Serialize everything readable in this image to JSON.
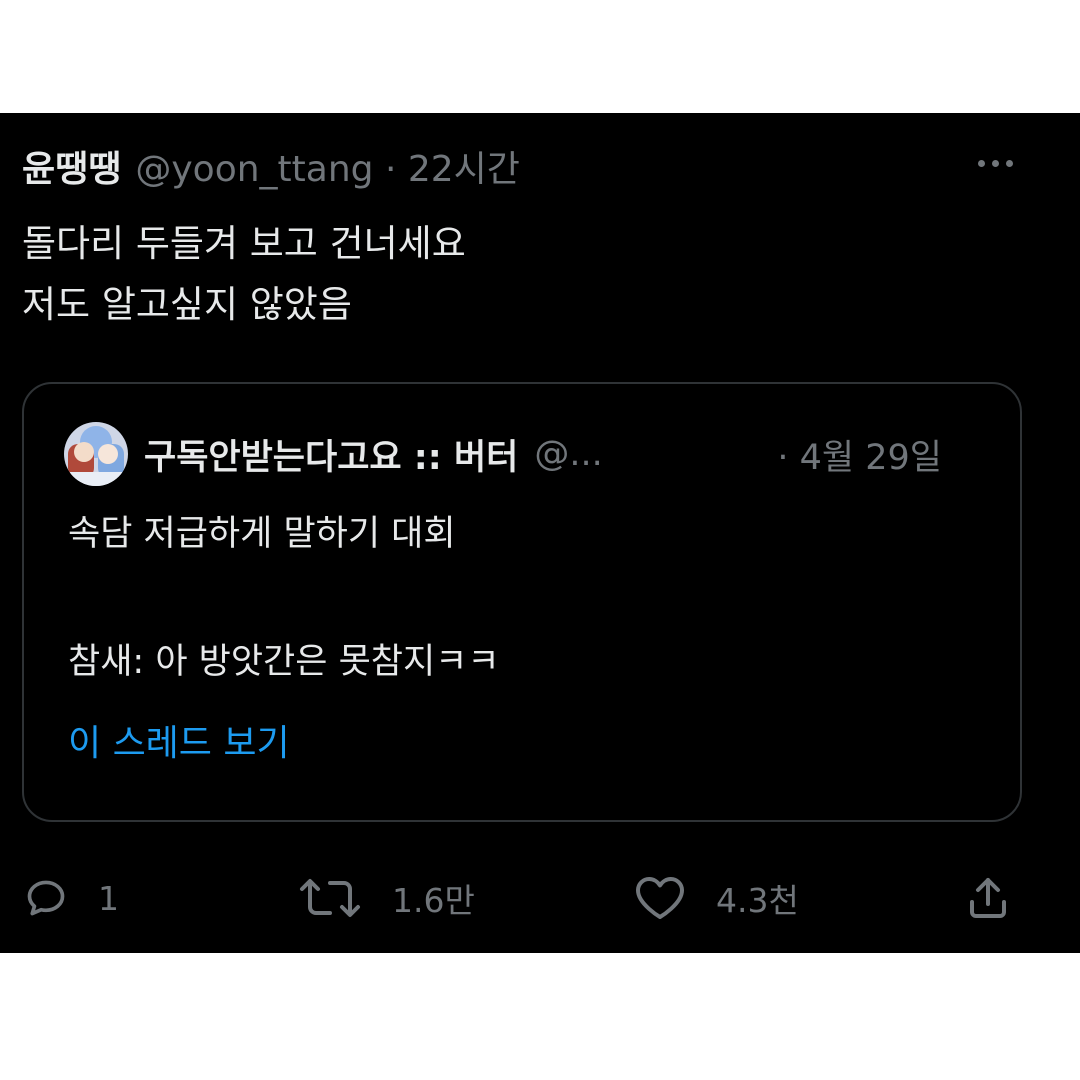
{
  "tweet": {
    "display_name": "윤땡땡",
    "meta": "@yoon_ttang · 22시간",
    "lines": [
      "돌다리 두들겨 보고 건너세요",
      "저도 알고싶지 않았음"
    ]
  },
  "quote": {
    "name": "구독안받는다고요 :: 버터",
    "handle": "@...",
    "date": "· 4월 29일",
    "lines": [
      "속담 저급하게 말하기 대회",
      "",
      "참새: 아 방앗간은 못참지ㅋㅋ"
    ],
    "thread_link": "이 스레드 보기"
  },
  "actions": {
    "reply_count": "1",
    "retweet_count": "1.6만",
    "like_count": "4.3천"
  },
  "colors": {
    "background": "#000000",
    "text": "#e7e9ea",
    "secondary": "#71767b",
    "link": "#1d9bf0"
  },
  "icons": [
    "more-icon",
    "reply-icon",
    "retweet-icon",
    "like-icon",
    "share-icon"
  ]
}
